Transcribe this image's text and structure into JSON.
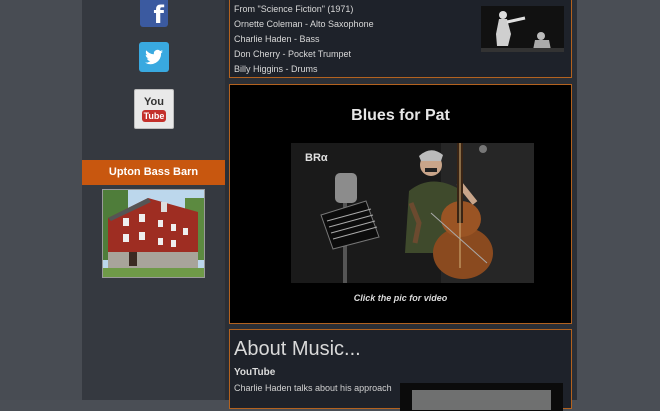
{
  "sidebar": {
    "social": {
      "facebook_glyph": "f",
      "youtube_you": "You",
      "youtube_tube": "Tube"
    },
    "barn_header": "Upton Bass Barn"
  },
  "top_panel": {
    "lines": [
      "From \"Science Fiction\" (1971)",
      "Ornette Coleman - Alto Saxophone",
      "Charlie Haden - Bass",
      "Don Cherry - Pocket Trumpet",
      "Billy Higgins - Drums"
    ]
  },
  "video_panel": {
    "title": "Blues for Pat",
    "caption": "Click the pic for video",
    "logo_text": "BRα"
  },
  "about_panel": {
    "heading": "About Music...",
    "subheading": "YouTube",
    "line": "Charlie Haden talks about his approach"
  },
  "colors": {
    "accent": "#c8570f",
    "panel_border": "#b3621f",
    "facebook": "#3b5aa0",
    "twitter": "#39a9e0"
  }
}
